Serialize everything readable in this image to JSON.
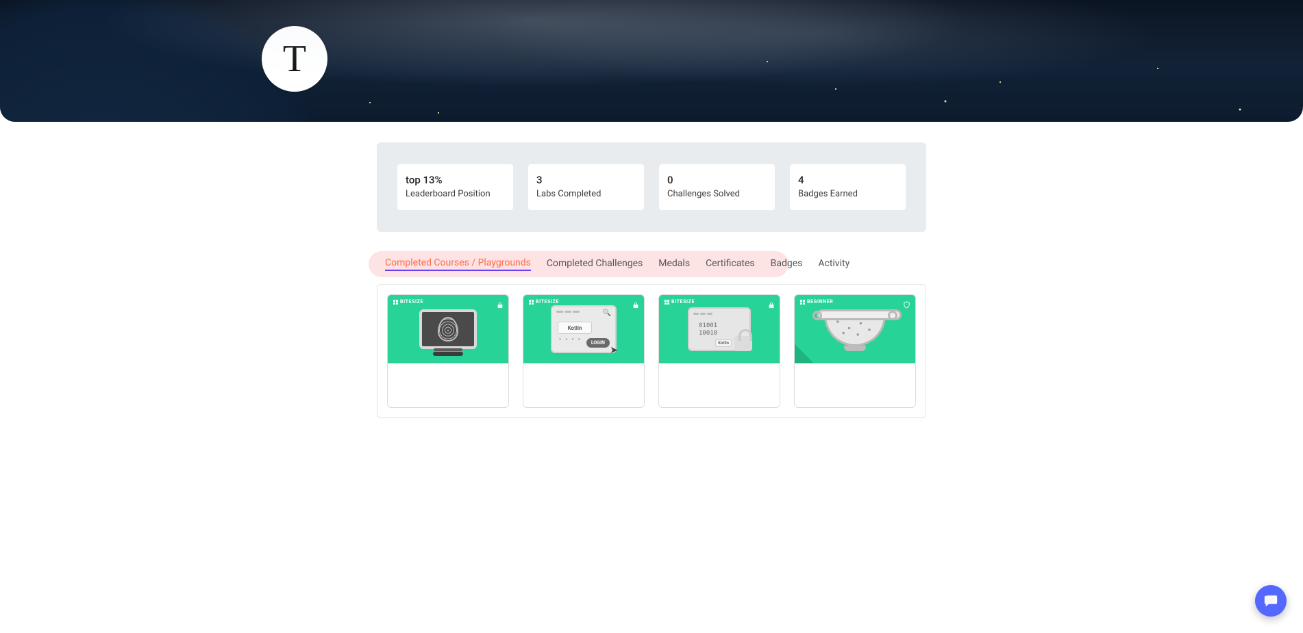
{
  "profile": {
    "avatar_initial": "T"
  },
  "stats": [
    {
      "value": "top 13%",
      "label": "Leaderboard Position"
    },
    {
      "value": "3",
      "label": "Labs Completed"
    },
    {
      "value": "0",
      "label": "Challenges Solved"
    },
    {
      "value": "4",
      "label": "Badges Earned"
    }
  ],
  "tabs": [
    {
      "label": "Completed Courses / Playgrounds",
      "active": true
    },
    {
      "label": "Completed Challenges",
      "active": false
    },
    {
      "label": "Medals",
      "active": false
    },
    {
      "label": "Certificates",
      "active": false
    },
    {
      "label": "Badges",
      "active": false
    },
    {
      "label": "Activity",
      "active": false
    }
  ],
  "cards": [
    {
      "level": "BITESIZE",
      "corner": "lock",
      "variant": "monitor",
      "kotlin_text": ""
    },
    {
      "level": "BITESIZE",
      "corner": "lock",
      "variant": "browser",
      "kotlin_text": "Kotlin",
      "login_text": "LOGIN"
    },
    {
      "level": "BITESIZE",
      "corner": "lock",
      "variant": "folder",
      "kotlin_text": "Kotlin",
      "binary_text": "01001\n10010"
    },
    {
      "level": "BEGINNER",
      "corner": "shield",
      "variant": "colander",
      "kotlin_text": ""
    }
  ]
}
